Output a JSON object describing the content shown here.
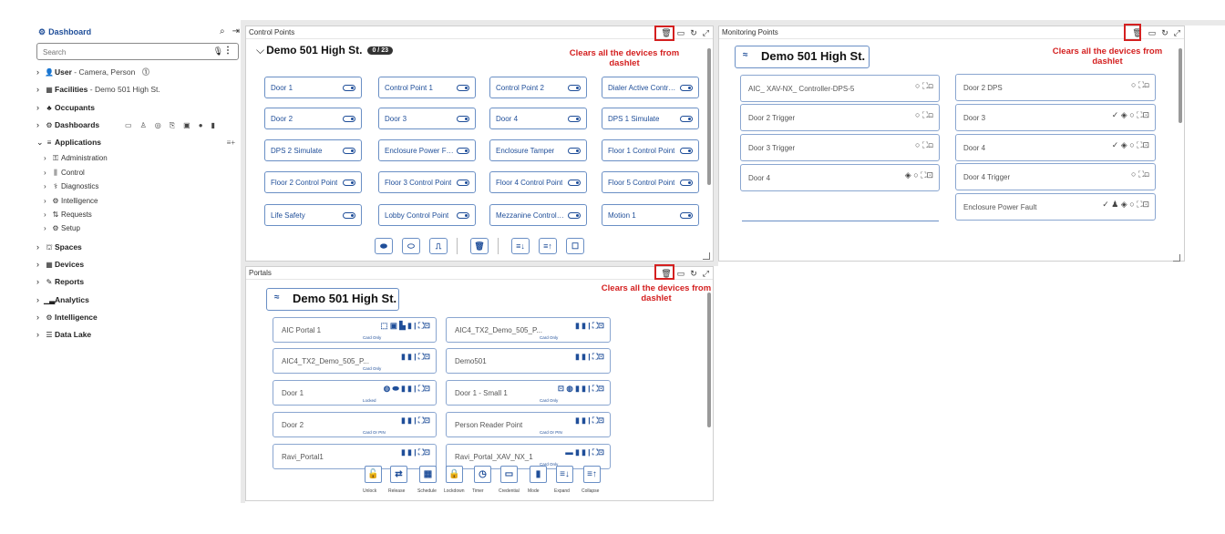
{
  "sidebar": {
    "title": "Dashboard",
    "title_icon": "dashboard-icon",
    "search_placeholder": "Search",
    "items": [
      {
        "label": "User",
        "detail": "- Camera, Person",
        "icon": "user-icon"
      },
      {
        "label": "Facilities",
        "detail": "- Demo 501 High St.",
        "icon": "facility-icon"
      },
      {
        "label": "Occupants",
        "detail": "",
        "icon": "occupants-icon"
      },
      {
        "label": "Dashboards",
        "detail": "",
        "icon": "dashboards-icon"
      },
      {
        "label": "Applications",
        "detail": "",
        "icon": "applications-icon"
      },
      {
        "label": "Spaces",
        "detail": "",
        "icon": "spaces-icon"
      },
      {
        "label": "Devices",
        "detail": "",
        "icon": "devices-icon"
      },
      {
        "label": "Reports",
        "detail": "",
        "icon": "reports-icon"
      },
      {
        "label": "Analytics",
        "detail": "",
        "icon": "analytics-icon"
      },
      {
        "label": "Intelligence",
        "detail": "",
        "icon": "intelligence-icon"
      },
      {
        "label": "Data Lake",
        "detail": "",
        "icon": "datalake-icon"
      }
    ],
    "applications_sub": [
      "Administration",
      "Control",
      "Diagnostics",
      "Intelligence",
      "Requests",
      "Setup"
    ]
  },
  "control_points": {
    "title": "Control Points",
    "location": "Demo 501 High St.",
    "count_badge": "0 / 23",
    "note": "Clears all the devices from dashlet",
    "cards": [
      "Door 1",
      "Control Point 1",
      "Control Point 2",
      "Dialer Active Contr…",
      "Door 2",
      "Door 3",
      "Door 4",
      "DPS 1 Simulate",
      "DPS 2 Simulate",
      "Enclosure Power F…",
      "Enclosure Tamper",
      "Floor 1 Control Point",
      "Floor 2 Control Point",
      "Floor 3 Control Point",
      "Floor 4 Control Point",
      "Floor 5 Control Point",
      "Life Safety",
      "Lobby Control Point",
      "Mezzanine Control…",
      "Motion 1"
    ]
  },
  "monitoring_points": {
    "title": "Monitoring Points",
    "location": "Demo 501 High St.",
    "note": "Clears all the devices from dashlet",
    "left_cards": [
      "AIC_ XAV-NX_ Controller-DPS-5",
      "Door 2 Trigger",
      "Door 3 Trigger",
      "Door 4"
    ],
    "right_cards": [
      "Door 2 DPS",
      "Door 3",
      "Door 4",
      "Door 4 Trigger",
      "Enclosure Power Fault"
    ]
  },
  "portals": {
    "title": "Portals",
    "location": "Demo 501 High St.",
    "note": "Clears all the devices from dashlet",
    "cards_left": [
      {
        "label": "AIC Portal 1",
        "status": "Card Only"
      },
      {
        "label": "AIC4_TX2_Demo_505_P...",
        "status": "Card Only"
      },
      {
        "label": "Door 1",
        "status": "Locked"
      },
      {
        "label": "Door 2",
        "status": "Card Or PIN"
      },
      {
        "label": "Ravi_Portal1",
        "status": ""
      }
    ],
    "cards_right": [
      {
        "label": "AIC4_TX2_Demo_505_P...",
        "status": "Card Only"
      },
      {
        "label": "Demo501",
        "status": ""
      },
      {
        "label": "Door 1 - Small 1",
        "status": "Card Only"
      },
      {
        "label": "Person Reader Point",
        "status": "Card Or PIN"
      },
      {
        "label": "Ravi_Portal_XAV_NX_1",
        "status": "Card Only"
      }
    ],
    "toolbar": [
      "Unlock",
      "Release",
      "Schedule",
      "Lockdown",
      "Timer",
      "Credential",
      "Mode",
      "Expand",
      "Collapse"
    ]
  },
  "colors": {
    "accent": "#1f4e99",
    "highlight": "#d42020",
    "border": "#6a8fc5"
  }
}
